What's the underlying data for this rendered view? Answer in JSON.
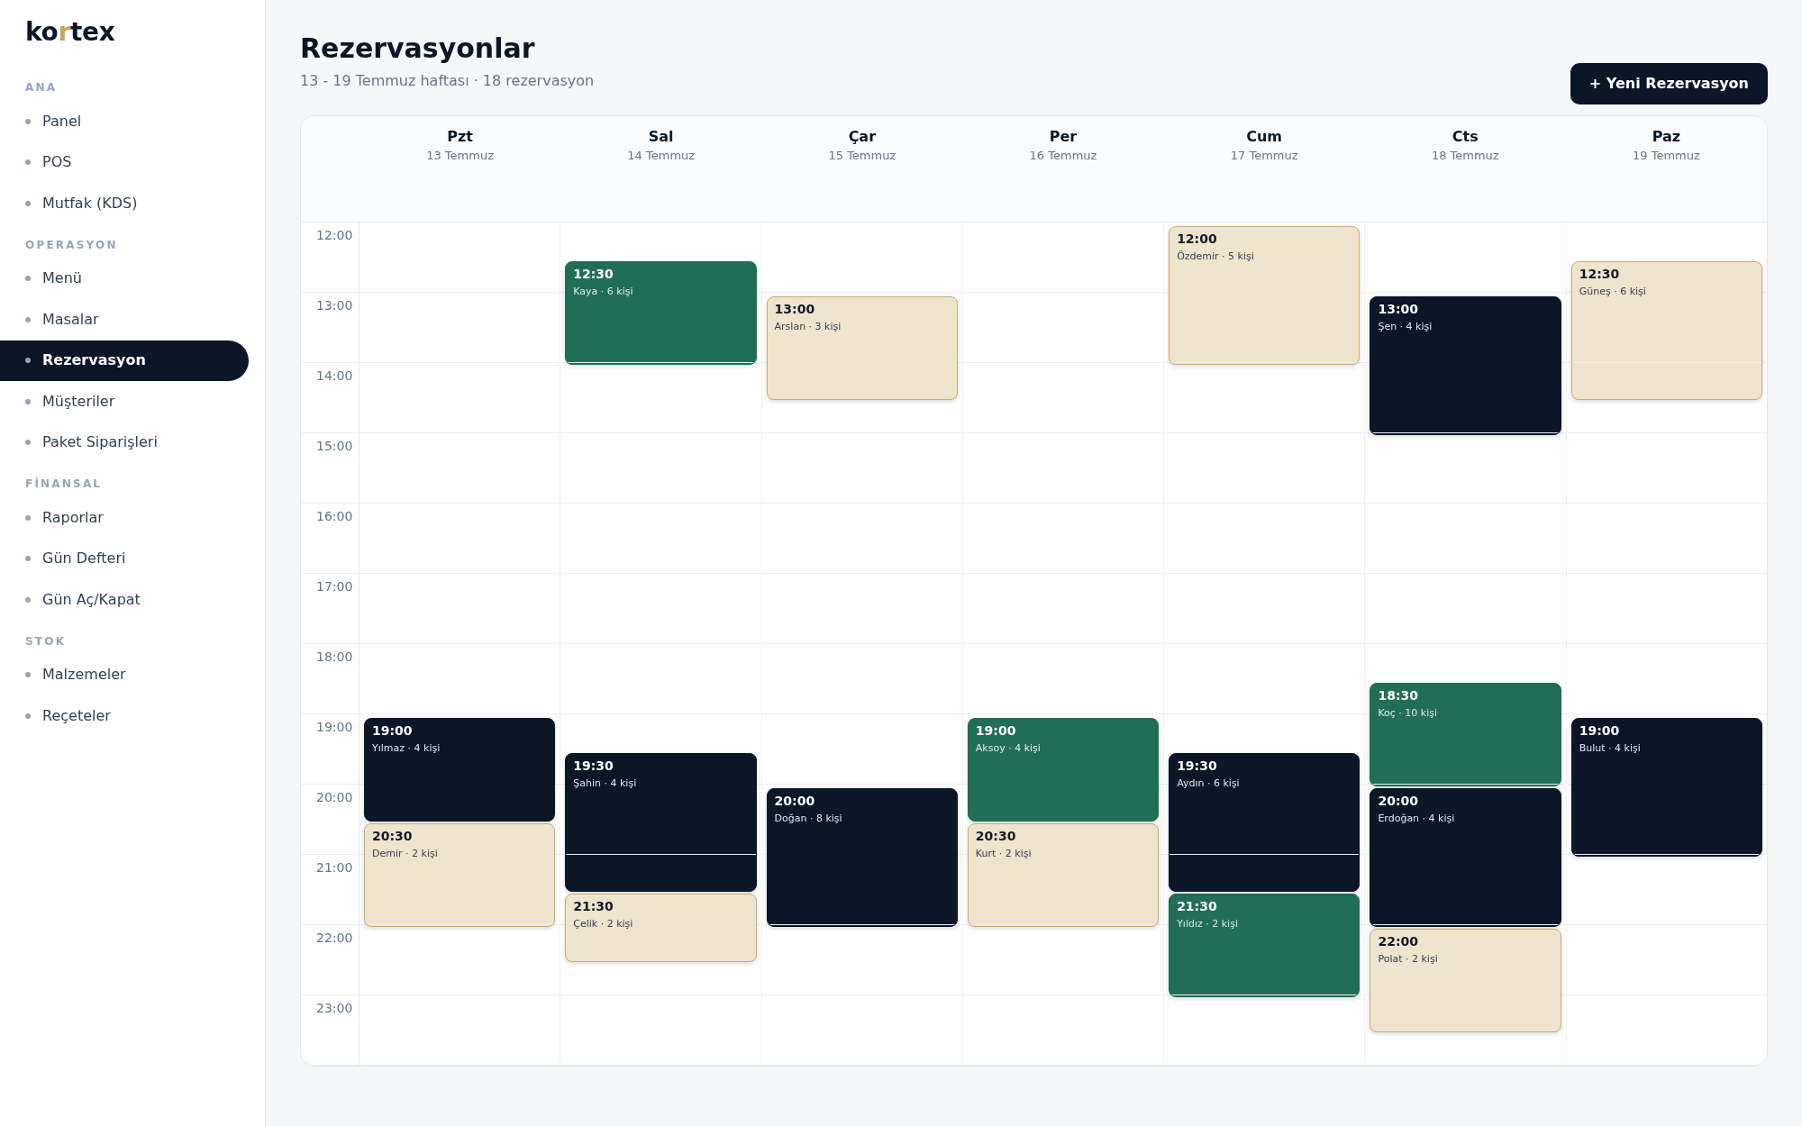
{
  "sidebar": {
    "logo": [
      {
        "text": "ko",
        "accent": false
      },
      {
        "text": "r",
        "accent": true
      },
      {
        "text": "tex",
        "accent": false
      }
    ],
    "sections": [
      {
        "title": "ANA",
        "items": [
          {
            "label": "Panel",
            "selected": false
          },
          {
            "label": "POS",
            "selected": false
          },
          {
            "label": "Mutfak (KDS)",
            "selected": false
          }
        ]
      },
      {
        "title": "OPERASYON",
        "items": [
          {
            "label": "Menü",
            "selected": false
          },
          {
            "label": "Masalar",
            "selected": false
          },
          {
            "label": "Rezervasyon",
            "selected": true
          },
          {
            "label": "Müşteriler",
            "selected": false
          },
          {
            "label": "Paket Siparişleri",
            "selected": false
          }
        ]
      },
      {
        "title": "FİNANSAL",
        "items": [
          {
            "label": "Raporlar",
            "selected": false
          },
          {
            "label": "Gün Defteri",
            "selected": false
          },
          {
            "label": "Gün Aç/Kapat",
            "selected": false
          }
        ]
      },
      {
        "title": "STOK",
        "items": [
          {
            "label": "Malzemeler",
            "selected": false
          },
          {
            "label": "Reçeteler",
            "selected": false
          }
        ]
      }
    ]
  },
  "header": {
    "title": "Rezervasyonlar",
    "subtitle": "13 - 19 Temmuz haftası · 18 rezervasyon",
    "button": "+ Yeni Rezervasyon"
  },
  "calendar": {
    "hours": [
      "12:00",
      "13:00",
      "14:00",
      "15:00",
      "16:00",
      "17:00",
      "18:00",
      "19:00",
      "20:00",
      "21:00",
      "22:00",
      "23:00"
    ],
    "days": [
      {
        "name": "Pzt",
        "date": "13 Temmuz",
        "reservations": [
          {
            "time": "19:00",
            "guest": "Yılmaz · 4 kişi",
            "color": "#0b1627",
            "kind": "medium"
          },
          {
            "time": "20:30",
            "guest": "Demir · 2 kişi",
            "color": "#efe4cd",
            "kind": "medium"
          }
        ]
      },
      {
        "name": "Sal",
        "date": "14 Temmuz",
        "reservations": [
          {
            "time": "12:30",
            "guest": "Kaya · 6 kişi",
            "color": "#216e56",
            "kind": "medium"
          },
          {
            "time": "19:30",
            "guest": "Şahin · 4 kişi",
            "color": "#0b1627",
            "kind": "long"
          },
          {
            "time": "21:30",
            "guest": "Çelik · 2 kişi",
            "color": "#efe4cd",
            "kind": "short"
          }
        ]
      },
      {
        "name": "Çar",
        "date": "15 Temmuz",
        "reservations": [
          {
            "time": "13:00",
            "guest": "Arslan · 3 kişi",
            "color": "#efe4cd",
            "kind": "medium"
          },
          {
            "time": "20:00",
            "guest": "Doğan · 8 kişi",
            "color": "#0b1627",
            "kind": "long"
          }
        ]
      },
      {
        "name": "Per",
        "date": "16 Temmuz",
        "reservations": [
          {
            "time": "19:00",
            "guest": "Aksoy · 4 kişi",
            "color": "#216e56",
            "kind": "medium"
          },
          {
            "time": "20:30",
            "guest": "Kurt · 2 kişi",
            "color": "#efe4cd",
            "kind": "medium"
          }
        ]
      },
      {
        "name": "Cum",
        "date": "17 Temmuz",
        "reservations": [
          {
            "time": "12:00",
            "guest": "Özdemir · 5 kişi",
            "color": "#efe4cd",
            "kind": "long"
          },
          {
            "time": "19:30",
            "guest": "Aydın · 6 kişi",
            "color": "#0b1627",
            "kind": "long"
          },
          {
            "time": "21:30",
            "guest": "Yıldız · 2 kişi",
            "color": "#216e56",
            "kind": "medium"
          }
        ]
      },
      {
        "name": "Cts",
        "date": "18 Temmuz",
        "reservations": [
          {
            "time": "13:00",
            "guest": "Şen · 4 kişi",
            "color": "#0b1627",
            "kind": "long"
          },
          {
            "time": "18:30",
            "guest": "Koç · 10 kişi",
            "color": "#216e56",
            "kind": "medium"
          },
          {
            "time": "20:00",
            "guest": "Erdoğan · 4 kişi",
            "color": "#0b1627",
            "kind": "long"
          },
          {
            "time": "22:00",
            "guest": "Polat · 2 kişi",
            "color": "#efe4cd",
            "kind": "medium"
          }
        ]
      },
      {
        "name": "Paz",
        "date": "19 Temmuz",
        "reservations": [
          {
            "time": "12:30",
            "guest": "Güneş · 6 kişi",
            "color": "#efe4cd",
            "kind": "long"
          },
          {
            "time": "19:00",
            "guest": "Bulut · 4 kişi",
            "color": "#0b1627",
            "kind": "long"
          }
        ]
      }
    ]
  }
}
